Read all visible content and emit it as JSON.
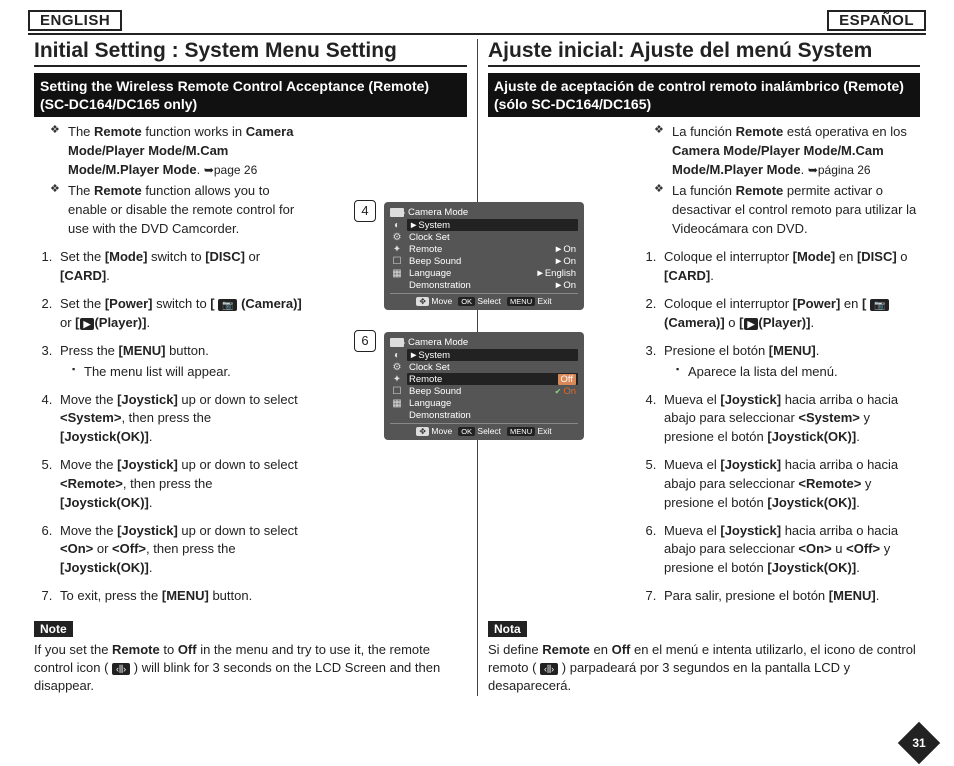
{
  "lang_labels": {
    "left": "ENGLISH",
    "right": "ESPAÑOL"
  },
  "page_number": "31",
  "left": {
    "title": "Initial Setting : System Menu Setting",
    "subtitle": "Setting the Wireless Remote Control Acceptance (Remote) (SC-DC164/DC165 only)",
    "bullets": [
      "The <b>Remote</b> function works in <b>Camera Mode/Player Mode/M.Cam Mode/M.Player Mode</b>. <span class='arrow-ref'>➥page 26</span>",
      "The <b>Remote</b> function allows you to enable or disable the remote control for use with the DVD Camcorder."
    ],
    "steps": [
      "Set the <b>[Mode]</b> switch to <b>[DISC]</b> or <b>[CARD]</b>.",
      "Set the <b>[Power]</b> switch to <b>[ <span class='inline-icon' data-name='camera-icon'>📷</span> (Camera)]</b> or <b>[<span class='inline-icon' data-name='play-icon'>▶</span>(Player)]</b>.",
      "Press the <b>[MENU]</b> button.<ul class='sub-bullet'><li>The menu list will appear.</li></ul>",
      "Move the <b>[Joystick]</b> up or down to select <b>&lt;System&gt;</b>, then press the <b>[Joystick(OK)]</b>.",
      "Move the <b>[Joystick]</b> up or down to select <b>&lt;Remote&gt;</b>, then press the <b>[Joystick(OK)]</b>.",
      "Move the <b>[Joystick]</b> up or down to select <b>&lt;On&gt;</b> or <b>&lt;Off&gt;</b>, then press the <b>[Joystick(OK)]</b>.",
      "To exit, press the <b>[MENU]</b> button."
    ],
    "note_label": "Note",
    "note": "If you set the <b>Remote</b> to <b>Off</b> in the menu and try to use it, the remote control icon ( <span class='inline-icon' data-name='remote-icon'>‹⫼›</span> ) will blink for 3 seconds on the LCD Screen and then disappear."
  },
  "right": {
    "title": "Ajuste inicial: Ajuste del menú System",
    "subtitle": "Ajuste de aceptación de control remoto inalámbrico (Remote) (sólo SC-DC164/DC165)",
    "bullets": [
      "La función <b>Remote</b> está operativa en los <b>Camera Mode/Player Mode/M.Cam Mode/M.Player Mode</b>. <span class='arrow-ref'>➥página 26</span>",
      "La función <b>Remote</b> permite activar o desactivar el control remoto para utilizar la Videocámara con DVD."
    ],
    "steps": [
      "Coloque el interruptor <b>[Mode]</b> en <b>[DISC]</b> o <b>[CARD]</b>.",
      "Coloque el interruptor <b>[Power]</b> en <b>[ <span class='inline-icon' data-name='camera-icon'>📷</span> (Camera)]</b> o <b>[<span class='inline-icon' data-name='play-icon'>▶</span>(Player)]</b>.",
      "Presione el botón <b>[MENU]</b>.<ul class='sub-bullet'><li>Aparece la lista del menú.</li></ul>",
      "Mueva el <b>[Joystick]</b> hacia arriba o hacia abajo para seleccionar <b>&lt;System&gt;</b> y presione el botón <b>[Joystick(OK)]</b>.",
      "Mueva el <b>[Joystick]</b> hacia arriba o hacia abajo para seleccionar <b>&lt;Remote&gt;</b> y presione el botón <b>[Joystick(OK)]</b>.",
      "Mueva el <b>[Joystick]</b> hacia arriba o hacia abajo para seleccionar <b>&lt;On&gt;</b> u <b>&lt;Off&gt;</b> y presione el botón <b>[Joystick(OK)]</b>.",
      "Para salir, presione el botón <b>[MENU]</b>."
    ],
    "note_label": "Nota",
    "note": "Si define <b>Remote</b> en <b>Off</b> en el menú e intenta utilizarlo, el icono de control remoto ( <span class='inline-icon' data-name='remote-icon'>‹⫼›</span> ) parpadeará por 3 segundos en la pantalla LCD y desaparecerá."
  },
  "screens": {
    "a": {
      "step": "4",
      "mode": "Camera Mode",
      "highlight": "System",
      "rows": [
        {
          "l": "Clock Set",
          "r": ""
        },
        {
          "l": "Remote",
          "r": "►On"
        },
        {
          "l": "Beep Sound",
          "r": "►On"
        },
        {
          "l": "Language",
          "r": "►English"
        },
        {
          "l": "Demonstration",
          "r": "►On"
        }
      ],
      "hints": {
        "move": "Move",
        "select": "Select",
        "exit": "Exit",
        "ok": "OK",
        "menu": "MENU"
      }
    },
    "b": {
      "step": "6",
      "mode": "Camera Mode",
      "highlight_top": "System",
      "rows": [
        {
          "l": "Clock Set",
          "r": ""
        },
        {
          "l": "Remote",
          "r_off": "Off",
          "sel": true
        },
        {
          "l": "Beep Sound",
          "r_on": "On"
        },
        {
          "l": "Language",
          "r": ""
        },
        {
          "l": "Demonstration",
          "r": ""
        }
      ],
      "hints": {
        "move": "Move",
        "select": "Select",
        "exit": "Exit",
        "ok": "OK",
        "menu": "MENU"
      }
    }
  }
}
